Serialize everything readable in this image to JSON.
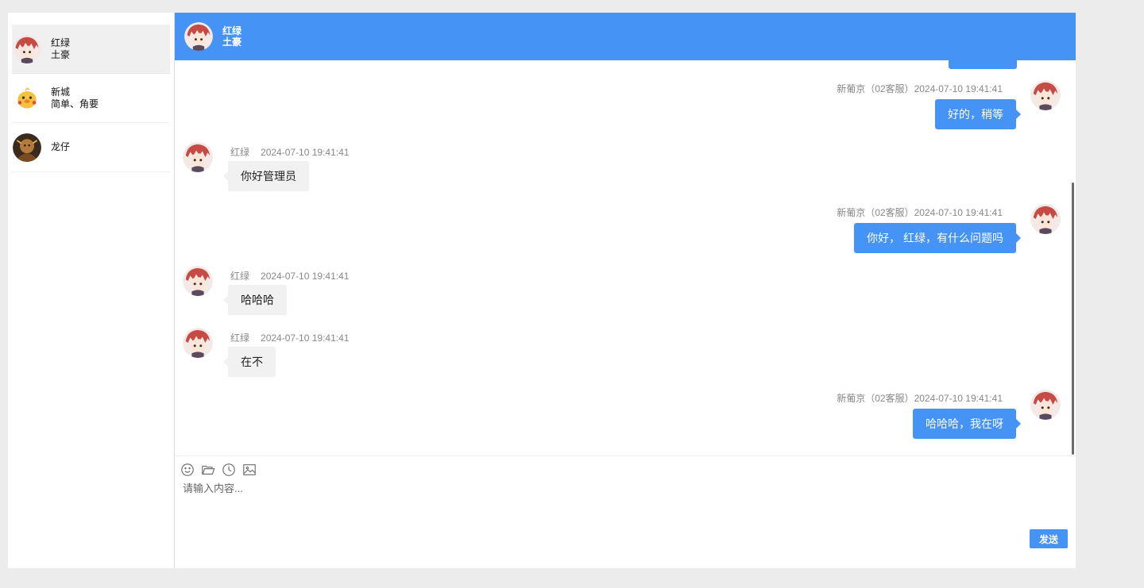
{
  "sidebar": {
    "contacts": [
      {
        "name": "红绿",
        "subtitle": "土豪",
        "active": true
      },
      {
        "name": "新城",
        "subtitle": "简单、角要",
        "active": false
      },
      {
        "name": "龙仔",
        "subtitle": "",
        "active": false
      }
    ]
  },
  "header": {
    "name": "红绿",
    "subtitle": "土豪"
  },
  "messages": [
    {
      "side": "right",
      "sender": "新葡京（02客服）",
      "time": "2024-07-10 19:41:41",
      "text": "好的，稍等"
    },
    {
      "side": "left",
      "sender": "红绿",
      "time": "2024-07-10 19:41:41",
      "text": "你好管理员"
    },
    {
      "side": "right",
      "sender": "新葡京（02客服）",
      "time": "2024-07-10 19:41:41",
      "text": "你好， 红绿，有什么问题吗"
    },
    {
      "side": "left",
      "sender": "红绿",
      "time": "2024-07-10 19:41:41",
      "text": "哈哈哈"
    },
    {
      "side": "left",
      "sender": "红绿",
      "time": "2024-07-10 19:41:41",
      "text": "在不"
    },
    {
      "side": "right",
      "sender": "新葡京（02客服）",
      "time": "2024-07-10 19:41:41",
      "text": "哈哈哈，我在呀"
    }
  ],
  "composer": {
    "placeholder": "请输入内容...",
    "send_label": "发送",
    "tools": [
      "smile-icon",
      "folder-icon",
      "clock-icon",
      "image-icon"
    ]
  },
  "colors": {
    "accent": "#4594f5",
    "incoming_bubble": "#f1f1f1",
    "page_bg": "#ececec"
  }
}
